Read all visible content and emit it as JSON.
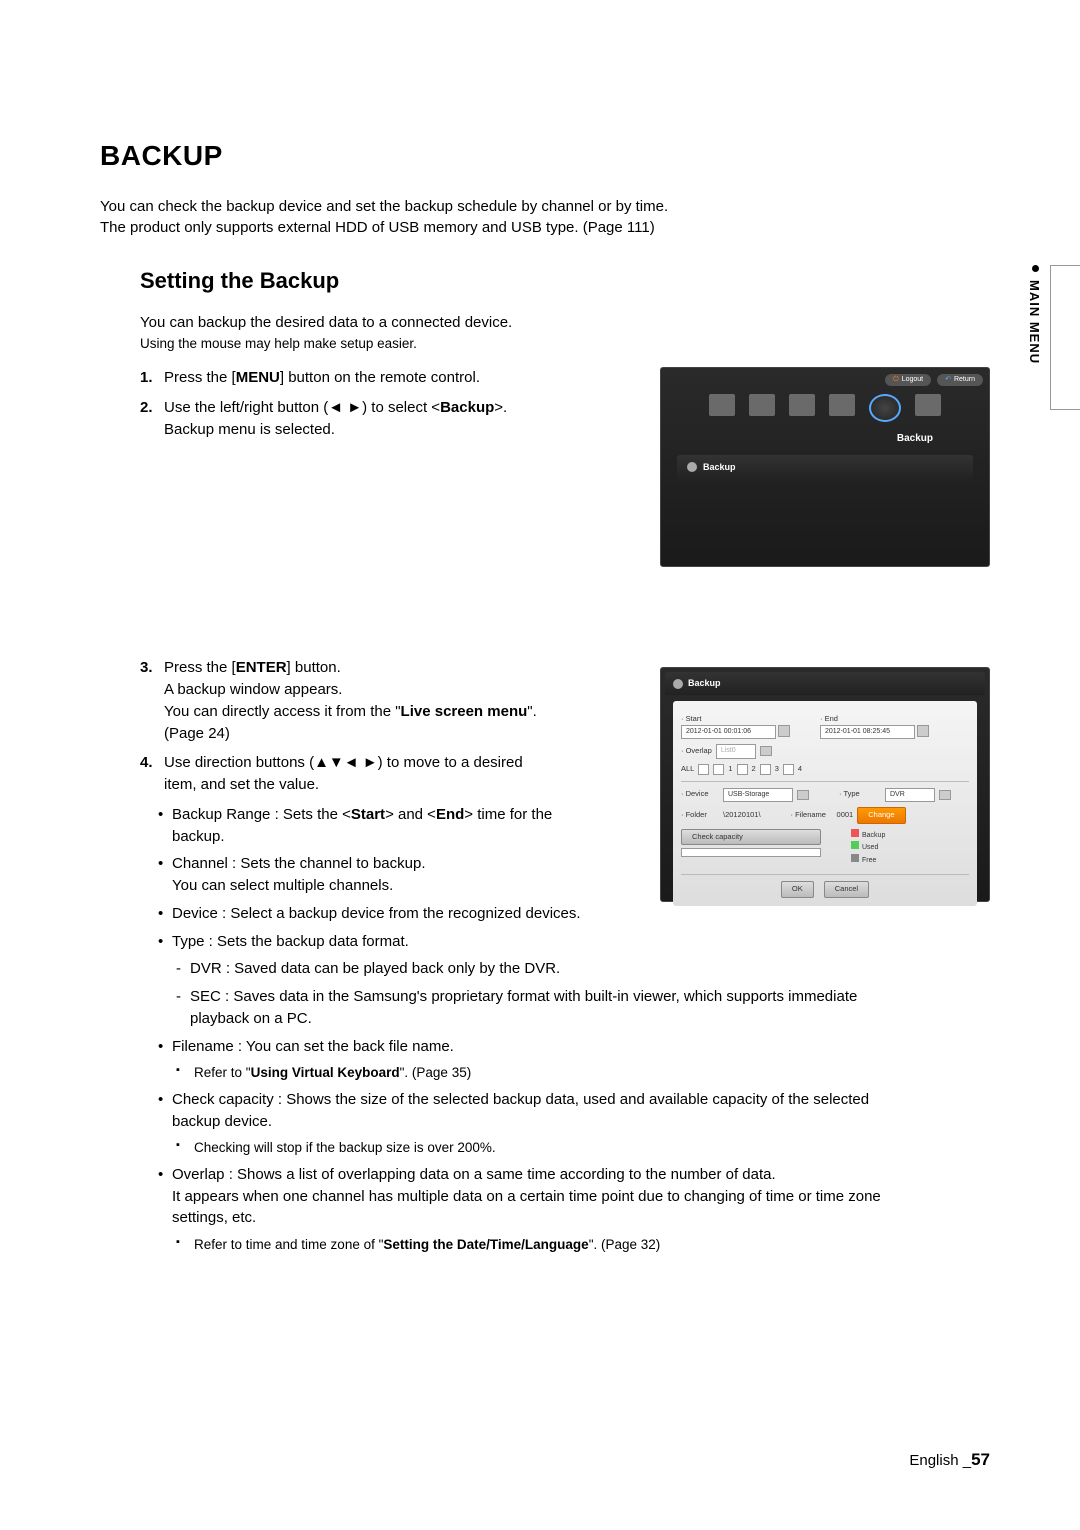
{
  "sideLabel": "MAIN MENU",
  "title": "BACKUP",
  "intro1": "You can check the backup device and set the backup schedule by channel or by time.",
  "intro2": "The product only supports external HDD of USB memory and USB type. (Page 111)",
  "subtitle": "Setting the Backup",
  "desc1": "You can backup the desired data to a connected device.",
  "desc2": "Using the mouse may help make setup easier.",
  "step1": {
    "n": "1.",
    "pre": "Press the [",
    "bold": "MENU",
    "post": "] button on the remote control."
  },
  "step2": {
    "n": "2.",
    "pre": "Use the left/right button (◄ ►) to select <",
    "bold": "Backup",
    "line2": "Backup menu is selected."
  },
  "step3": {
    "n": "3.",
    "pre": "Press the [",
    "bold": "ENTER",
    "post": "] button.",
    "l2": "A backup window appears.",
    "l3a": "You can directly access it from the \"",
    "l3b": "Live screen menu",
    "l3c": "\".",
    "l4": "(Page 24)"
  },
  "step4": {
    "n": "4.",
    "l1": "Use direction buttons (▲▼◄ ►) to move to a desired",
    "l2": "item, and set the value."
  },
  "bullets": {
    "range": {
      "t1": "Backup Range : Sets the <",
      "b1": "Start",
      "t2": "> and <",
      "b2": "End",
      "t3": "> time for the",
      "l2": "backup."
    },
    "channel": {
      "l1": "Channel : Sets the channel to backup.",
      "l2": "You can select multiple channels."
    },
    "device": "Device : Select a backup device from the recognized devices.",
    "type": "Type : Sets the backup data format.",
    "typeDvr": "DVR : Saved data can be played back only by the DVR.",
    "typeSec": {
      "l1": "SEC : Saves data in the Samsung's proprietary format with built-in viewer, which supports immediate",
      "l2": "playback on a PC."
    },
    "filename": "Filename : You can set the back file name.",
    "fileNote": {
      "t1": "Refer to \"",
      "b": "Using Virtual Keyboard",
      "t2": "\". (Page 35)"
    },
    "capacity": {
      "l1": "Check capacity : Shows the size of the selected backup data, used and available capacity of the selected",
      "l2": "backup device."
    },
    "capNote": "Checking will stop if the backup size is over 200%.",
    "overlap": {
      "l1": "Overlap : Shows a list of overlapping data on a same time according to the number of data.",
      "l2": "It appears when one channel has multiple data on a certain time point due to changing of time or time zone",
      "l3": "settings, etc."
    },
    "overlapNote": {
      "t1": "Refer to time and time zone of \"",
      "b": "Setting the Date/Time/Language",
      "t2": "\". (Page 32)"
    }
  },
  "shot1": {
    "logout": "Logout",
    "return": "Return",
    "tabLabel": "Backup",
    "submenu": "Backup"
  },
  "shot2": {
    "header": "Backup",
    "start": "· Start",
    "startVal": "2012-01-01 00:01:06",
    "end": "· End",
    "endVal": "2012-01-01 08:25:45",
    "overlap": "· Overlap",
    "overlapVal": "List0",
    "all": "ALL",
    "ch1": "1",
    "ch2": "2",
    "ch3": "3",
    "ch4": "4",
    "device": "· Device",
    "deviceVal": "USB-Storage",
    "type": "· Type",
    "typeVal": "DVR",
    "folder": "· Folder",
    "folderVal": "\\20120101\\",
    "filename": "· Filename",
    "filenameVal": "0001",
    "change": "Change",
    "checkCap": "Check capacity",
    "backup": "Backup",
    "used": "Used",
    "free": "Free",
    "ok": "OK",
    "cancel": "Cancel"
  },
  "footer": {
    "lang": "English _",
    "page": "57"
  }
}
